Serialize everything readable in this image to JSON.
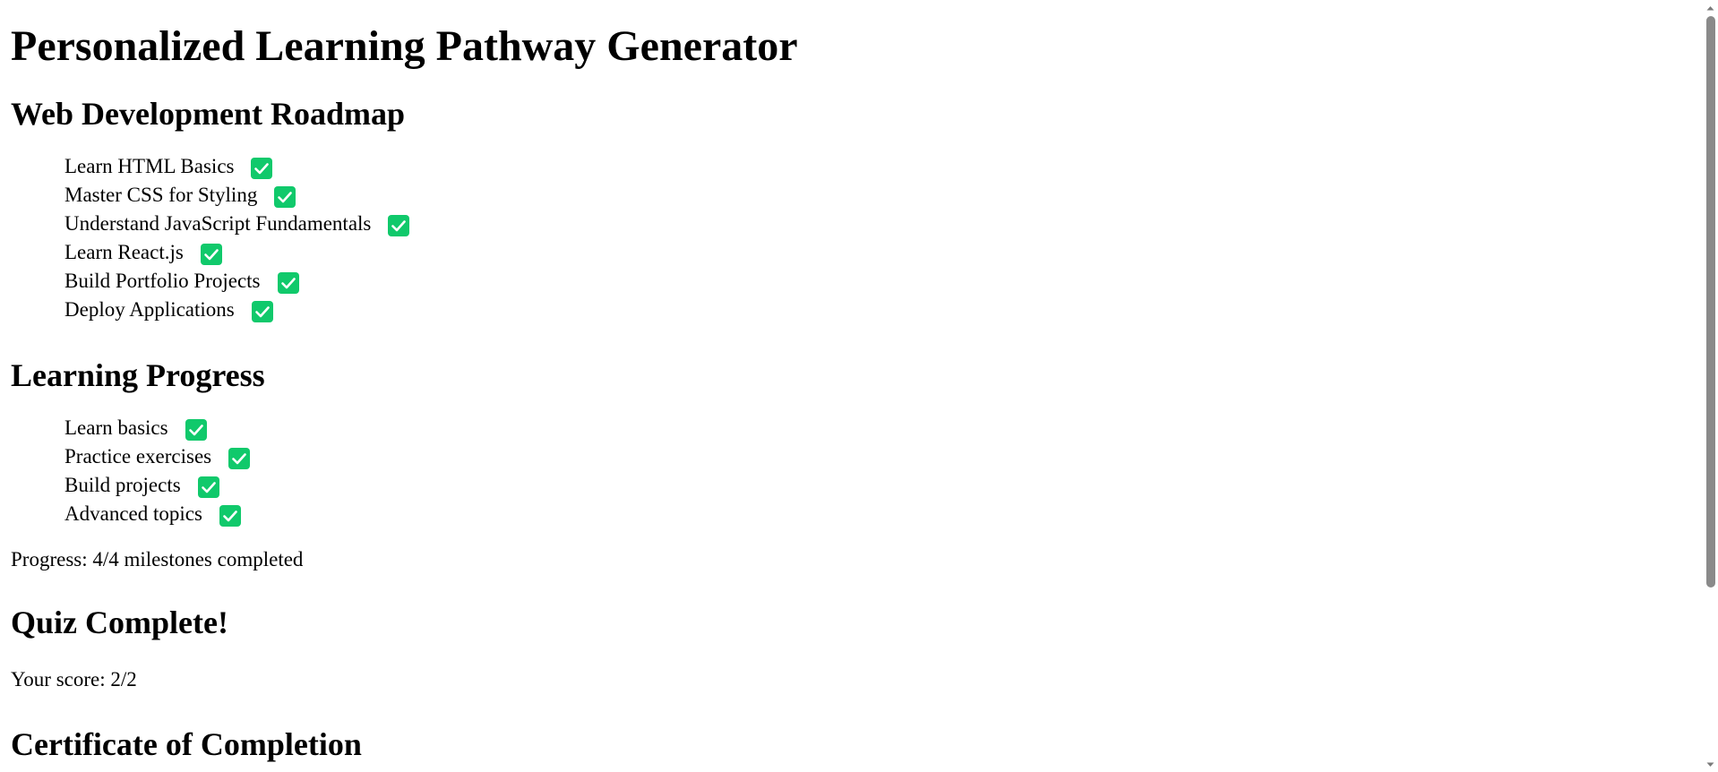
{
  "page": {
    "title": "Personalized Learning Pathway Generator"
  },
  "roadmap": {
    "heading": "Web Development Roadmap",
    "items": [
      {
        "label": "Learn HTML Basics",
        "completed": true
      },
      {
        "label": "Master CSS for Styling",
        "completed": true
      },
      {
        "label": "Understand JavaScript Fundamentals",
        "completed": true
      },
      {
        "label": "Learn React.js",
        "completed": true
      },
      {
        "label": "Build Portfolio Projects",
        "completed": true
      },
      {
        "label": "Deploy Applications",
        "completed": true
      }
    ]
  },
  "progress": {
    "heading": "Learning Progress",
    "items": [
      {
        "label": "Learn basics",
        "completed": true
      },
      {
        "label": "Practice exercises",
        "completed": true
      },
      {
        "label": "Build projects",
        "completed": true
      },
      {
        "label": "Advanced topics",
        "completed": true
      }
    ],
    "summary": "Progress: 4/4 milestones completed"
  },
  "quiz": {
    "heading": "Quiz Complete!",
    "score_text": "Your score: 2/2"
  },
  "certificate": {
    "heading": "Certificate of Completion"
  },
  "icons": {
    "check": "check-mark-icon",
    "scroll_up": "chevron-up-icon",
    "scroll_down": "chevron-down-icon"
  },
  "colors": {
    "check_green": "#10c96b",
    "scroll_thumb": "#8a8a8a"
  }
}
